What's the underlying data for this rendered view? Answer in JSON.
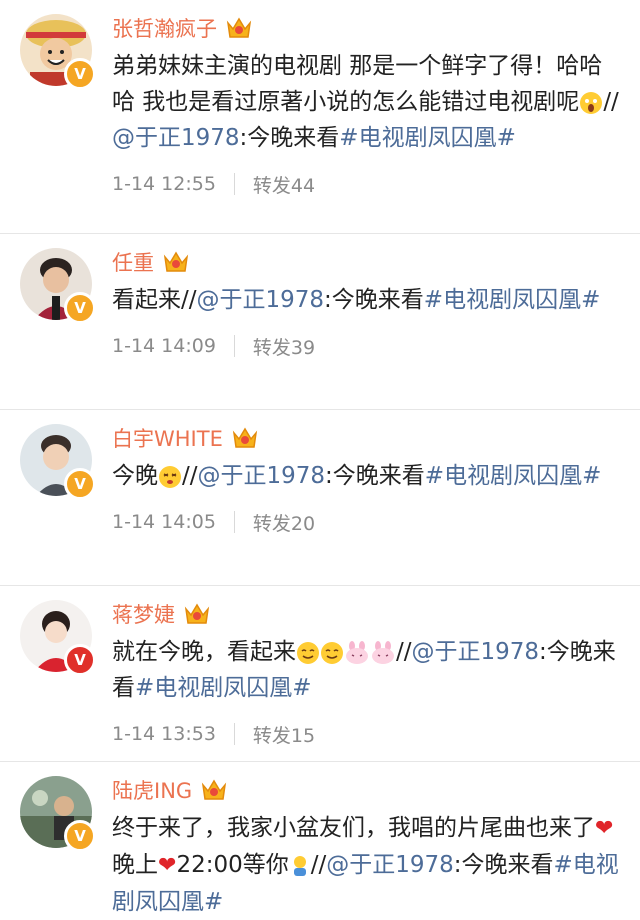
{
  "colors": {
    "name": "#eb7350",
    "link": "#4d6c98",
    "meta": "#8a8a8a",
    "verified_badge": "#f5a623",
    "heart": "#e0252a"
  },
  "comments": [
    {
      "name": "张哲瀚疯子",
      "text_before": "弟弟妹妹主演的电视剧 那是一个鲜字了得！哈哈哈 我也是看过原著小说的怎么能错过电视剧呢",
      "emoji1": "scared-face-emoji",
      "slashes": "//",
      "mention": "@于正1978",
      "colon_text": ":今晚来看",
      "hashtag": "#电视剧凤囚凰#",
      "time": "1-14 12:55",
      "repost": "转发44"
    },
    {
      "name": "任重",
      "text_before": "看起来",
      "slashes": "//",
      "mention": "@于正1978",
      "colon_text": ":今晚来看",
      "hashtag": "#电视剧凤囚凰#",
      "time": "1-14 14:09",
      "repost": "转发39"
    },
    {
      "name": "白宇WHITE",
      "text_before": "今晚",
      "emoji1": "fainting-face-emoji",
      "slashes": "//",
      "mention": "@于正1978",
      "colon_text": ":今晚来看",
      "hashtag": "#电视剧凤囚凰#",
      "time": "1-14 14:05",
      "repost": "转发20"
    },
    {
      "name": "蒋梦婕",
      "text_before": "就在今晚，看起来",
      "slashes": "//",
      "mention": "@于正1978",
      "colon_text": ":今晚来看",
      "hashtag": "#电视剧凤囚凰#",
      "time": "1-14 13:53",
      "repost": "转发15"
    },
    {
      "name": "陆虎ING",
      "text_before": "终于来了，我家小盆友们，我唱的片尾曲也来了",
      "heart": "❤",
      "text_mid": "晚上",
      "text_after": "22:00等你",
      "slashes": "//",
      "mention": "@于正1978",
      "colon_text": ":今晚来看",
      "hashtag": "#电视剧凤囚凰#"
    }
  ]
}
